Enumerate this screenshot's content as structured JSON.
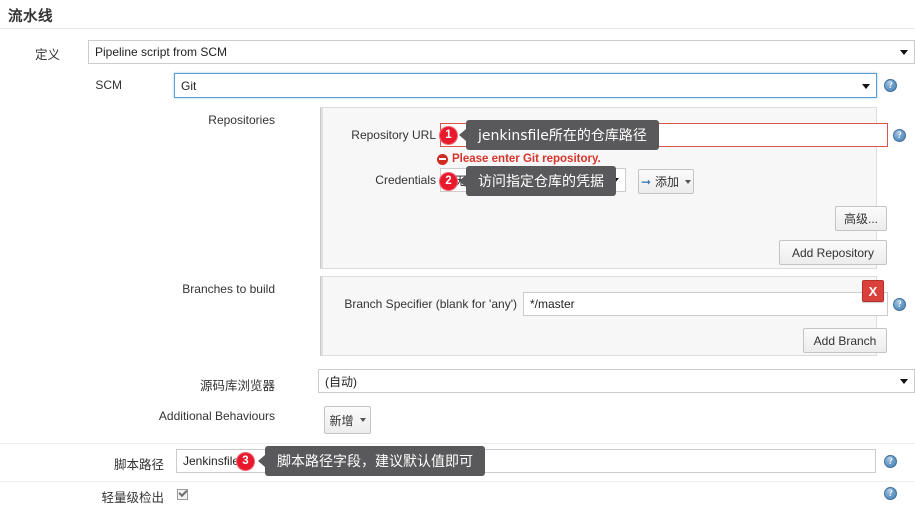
{
  "page": {
    "title": "流水线"
  },
  "definition": {
    "label": "定义",
    "value": "Pipeline script from SCM"
  },
  "scm": {
    "label": "SCM",
    "value": "Git",
    "help_icon": "help-icon",
    "help_glyph": "?"
  },
  "repositories": {
    "label": "Repositories",
    "repository_url": {
      "label": "Repository URL",
      "value": "",
      "error": "Please enter Git repository.",
      "error_icon": "error-icon",
      "help_glyph": "?"
    },
    "credentials": {
      "label": "Credentials",
      "value": "- 无 -",
      "add_button": "添加",
      "add_button_icon": "left-arrow-icon"
    },
    "advanced_button": "高级...",
    "add_repository_button": "Add Repository"
  },
  "branches": {
    "label": "Branches to build",
    "specifier_label": "Branch Specifier (blank for 'any')",
    "specifier_value": "*/master",
    "add_branch_button": "Add Branch",
    "delete_button": "X",
    "help_glyph": "?"
  },
  "repo_browser": {
    "label": "源码库浏览器",
    "value": "(自动)",
    "help_glyph": "?"
  },
  "additional_behaviours": {
    "label": "Additional Behaviours",
    "add_button": "新增"
  },
  "script_path": {
    "label": "脚本路径",
    "value": "Jenkinsfile",
    "help_glyph": "?"
  },
  "lightweight_checkout": {
    "label": "轻量级检出",
    "checked": true,
    "help_glyph": "?"
  },
  "annotations": [
    {
      "number": "1",
      "tooltip": "jenkinsfile所在的仓库路径"
    },
    {
      "number": "2",
      "tooltip": "访问指定仓库的凭据"
    },
    {
      "number": "3",
      "tooltip": "脚本路径字段，建议默认值即可"
    }
  ],
  "colors": {
    "badge_red": "#e8192c",
    "tooltip_gray": "#59595b",
    "error_red": "#d9342b",
    "delete_red": "#d9413a",
    "focus_blue": "#5a9fd4"
  }
}
